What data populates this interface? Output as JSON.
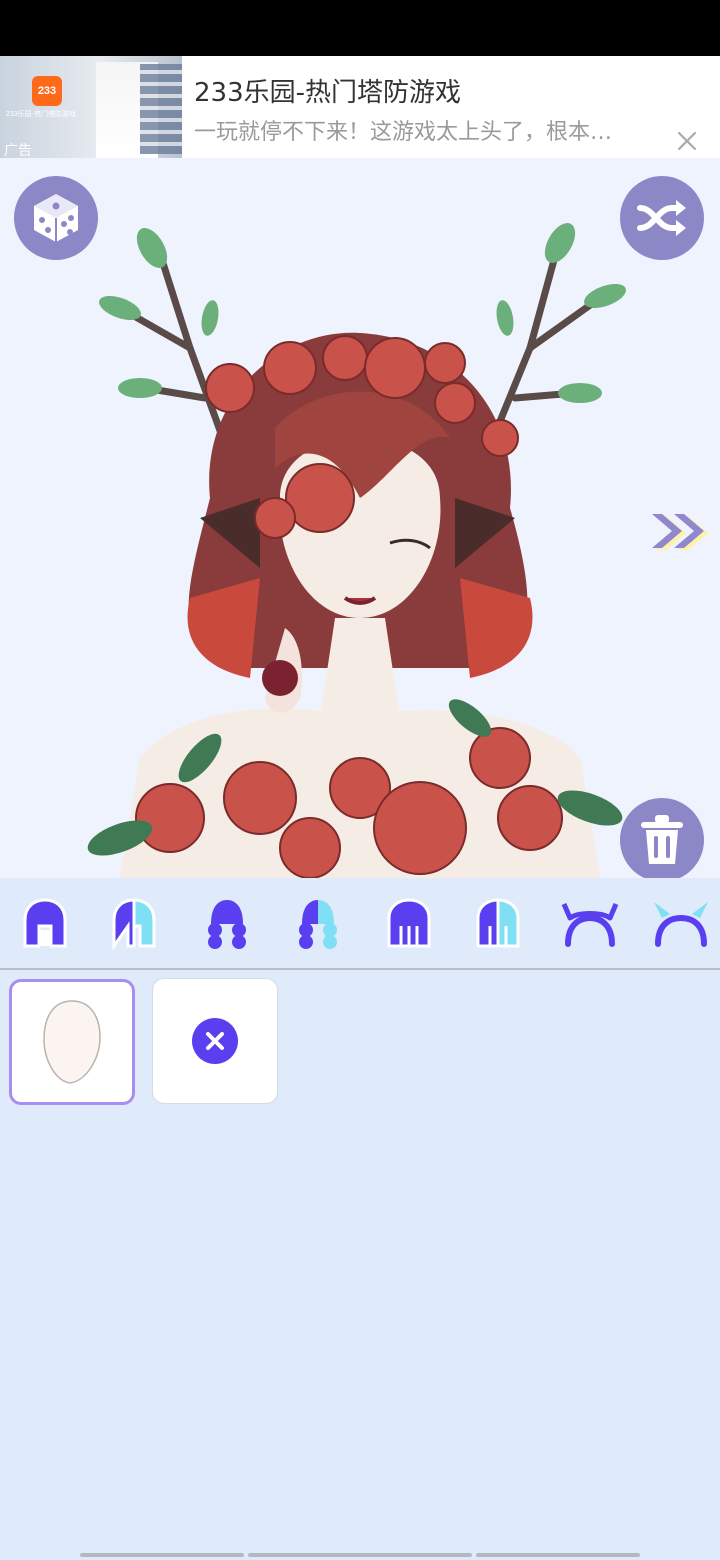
{
  "ad": {
    "logo_text": "233",
    "thumb_caption": "233乐园-热门塔防游戏",
    "tag": "广告",
    "title": "233乐园-热门塔防游戏",
    "subtitle": "一玩就停不下来！这游戏太上头了，根本…",
    "close_icon": "close-icon"
  },
  "canvas": {
    "dice_icon": "dice-icon",
    "shuffle_icon": "shuffle-icon",
    "next_icon": "double-chevron-right-icon",
    "trash_icon": "trash-icon"
  },
  "part_tabs": [
    {
      "name": "hair-front-solid",
      "icon": "hair-front-icon",
      "variant": "solid"
    },
    {
      "name": "hair-front-dual",
      "icon": "hair-front-icon",
      "variant": "dual"
    },
    {
      "name": "hair-braid-solid",
      "icon": "hair-braid-icon",
      "variant": "solid"
    },
    {
      "name": "hair-braid-dual",
      "icon": "hair-braid-icon",
      "variant": "dual"
    },
    {
      "name": "hair-back-solid",
      "icon": "hair-back-icon",
      "variant": "solid"
    },
    {
      "name": "hair-back-dual",
      "icon": "hair-back-icon",
      "variant": "dual"
    },
    {
      "name": "horns-solid",
      "icon": "horns-icon",
      "variant": "solid"
    },
    {
      "name": "horns-dual",
      "icon": "horns-icon",
      "variant": "dual"
    }
  ],
  "options": [
    {
      "name": "face-shape-option",
      "icon": "face-shape-icon",
      "selected": true
    },
    {
      "name": "none-option",
      "icon": "remove-icon",
      "selected": false
    }
  ],
  "colors": {
    "accent": "#5a3ff0",
    "accent_light": "#7fe0f5",
    "button_bg": "#8c88c7",
    "selected_border": "#a88ef0",
    "panel_bg": "#dfeafb"
  }
}
